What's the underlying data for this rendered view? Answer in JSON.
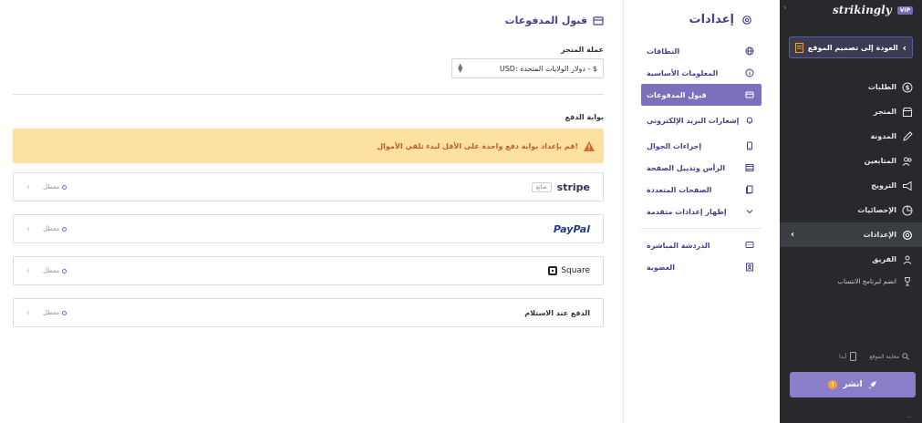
{
  "app": {
    "brand": "strikingly",
    "vip_badge": "VIP",
    "back_button": "العودة إلى تصميم الموقع",
    "menu": [
      {
        "label": "الطلبات",
        "icon": "dollar-icon"
      },
      {
        "label": "المتجر",
        "icon": "store-icon"
      },
      {
        "label": "المدونة",
        "icon": "pen-icon"
      },
      {
        "label": "المتابعين",
        "icon": "users-icon"
      },
      {
        "label": "الترويج",
        "icon": "megaphone-icon"
      },
      {
        "label": "الإحصائيات",
        "icon": "pie-chart-icon"
      },
      {
        "label": "الإعدادات",
        "icon": "gear-icon",
        "active": true
      },
      {
        "label": "الفريق",
        "icon": "team-icon"
      }
    ],
    "affiliate": "انضم لبرنامج الانتساب",
    "bottom": {
      "preview": "معاينة الموقع",
      "mobile": "أيدا"
    },
    "publish": "انشر",
    "footer": "..."
  },
  "settings_nav": {
    "title": "إعدادات",
    "items": [
      {
        "label": "النطاقات",
        "icon": "globe-icon"
      },
      {
        "label": "المعلومات الأساسية",
        "icon": "info-icon"
      },
      {
        "label": "قبول المدفوعات",
        "icon": "card-icon",
        "active": true
      },
      {
        "label": "إشعارات البريد الإلكتروني",
        "icon": "bell-icon"
      },
      {
        "label": "إجراءات الجوال",
        "icon": "mobile-icon"
      },
      {
        "label": "الرأس وتذييل الصفحة",
        "icon": "layout-icon"
      },
      {
        "label": "الصفحات المتعددة",
        "icon": "pages-icon"
      },
      {
        "label": "إظهار إعدادات متقدمة",
        "icon": "chevron-down-icon"
      }
    ],
    "items2": [
      {
        "label": "الدردشة المباشرة",
        "icon": "chat-icon"
      },
      {
        "label": "العضوية",
        "icon": "member-icon"
      }
    ]
  },
  "main": {
    "title": "قبول المدفوعات",
    "currency_label": "عملة المتجر",
    "currency_value": "USD: دولار الولايات المتحدة - $",
    "gateway_label": "بوابة الدفع",
    "alert": "قم بإعداد بوابة دفع واحدة على الأقل لبدء تلقي الأموال!",
    "providers": [
      {
        "name": "stripe",
        "tag": "شائع",
        "status": "معطل"
      },
      {
        "name": "PayPal",
        "status": "معطل"
      },
      {
        "name": "Square",
        "status": "معطل"
      },
      {
        "name": "الدفع عند الاستلام",
        "status": "معطل"
      }
    ]
  }
}
